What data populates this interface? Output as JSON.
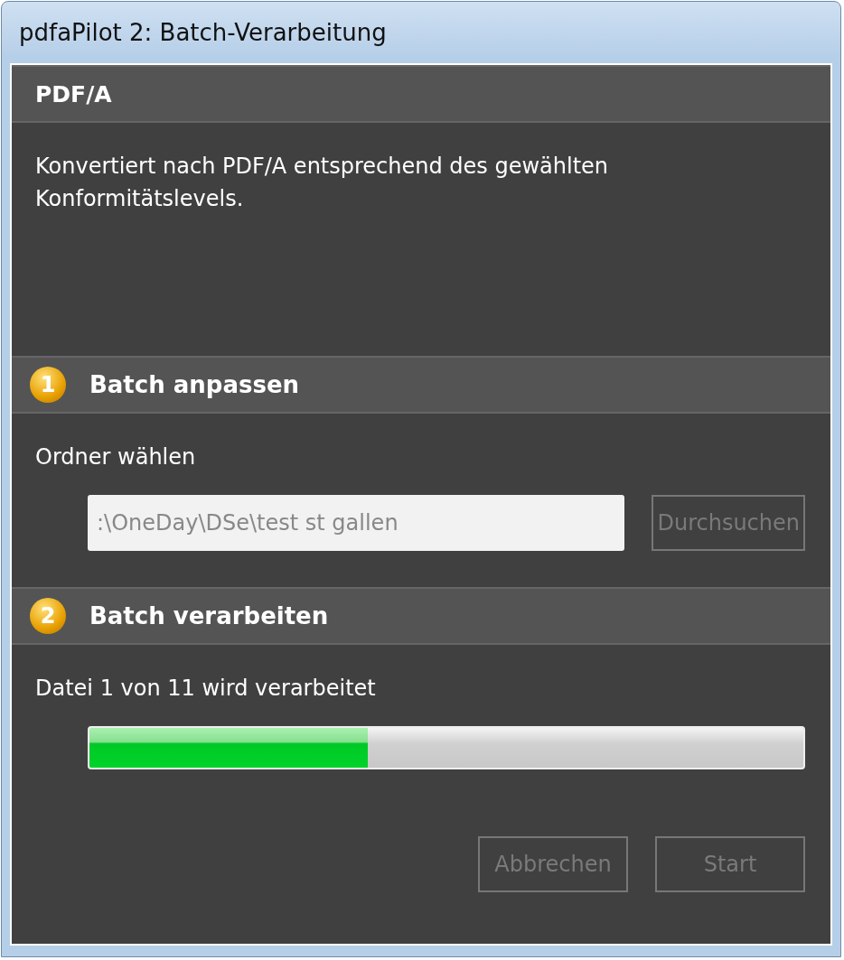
{
  "window": {
    "title": "pdfaPilot 2: Batch-Verarbeitung"
  },
  "header": {
    "title": "PDF/A",
    "description": "Konvertiert nach PDF/A entsprechend des gewählten Konformitätslevels."
  },
  "sections": [
    {
      "number": "1",
      "title": "Batch anpassen",
      "kind": "folder",
      "label": "Ordner wählen",
      "field": {
        "value": ":\\OneDay\\DSe\\test st gallen",
        "disabled": true
      },
      "button": {
        "label": "Durchsuchen",
        "disabled": true
      }
    },
    {
      "number": "2",
      "title": "Batch verarbeiten",
      "kind": "progress",
      "label": "Datei 1 von 11 wird verarbeitet",
      "level": 0.39
    }
  ],
  "buttons": [
    {
      "label": "Abbrechen",
      "disabled": true
    },
    {
      "label": "Start",
      "disabled": true
    }
  ]
}
